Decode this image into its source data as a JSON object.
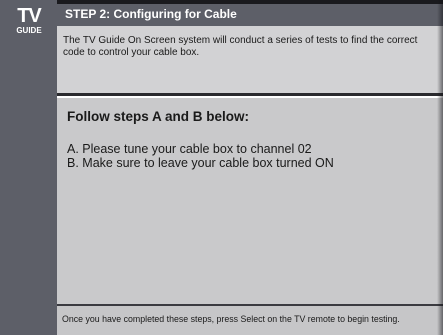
{
  "logo": {
    "line1": "TV",
    "line2": "GUIDE"
  },
  "header": {
    "title": "STEP 2: Configuring for Cable"
  },
  "intro": {
    "text": "The TV Guide On Screen system will conduct a series of tests to find the correct code to control your cable box."
  },
  "main": {
    "heading": "Follow steps A and B below:",
    "steps": [
      "A.  Please tune your cable box to channel 02",
      "B.  Make sure to leave your cable box turned ON"
    ]
  },
  "footer": {
    "text": "Once you have completed these steps, press Select on the TV remote to begin testing."
  },
  "colors": {
    "sidebar": "#5d5f68",
    "panel": "#c9c9cb",
    "text": "#1a1a1a",
    "header_text": "#ffffff"
  }
}
